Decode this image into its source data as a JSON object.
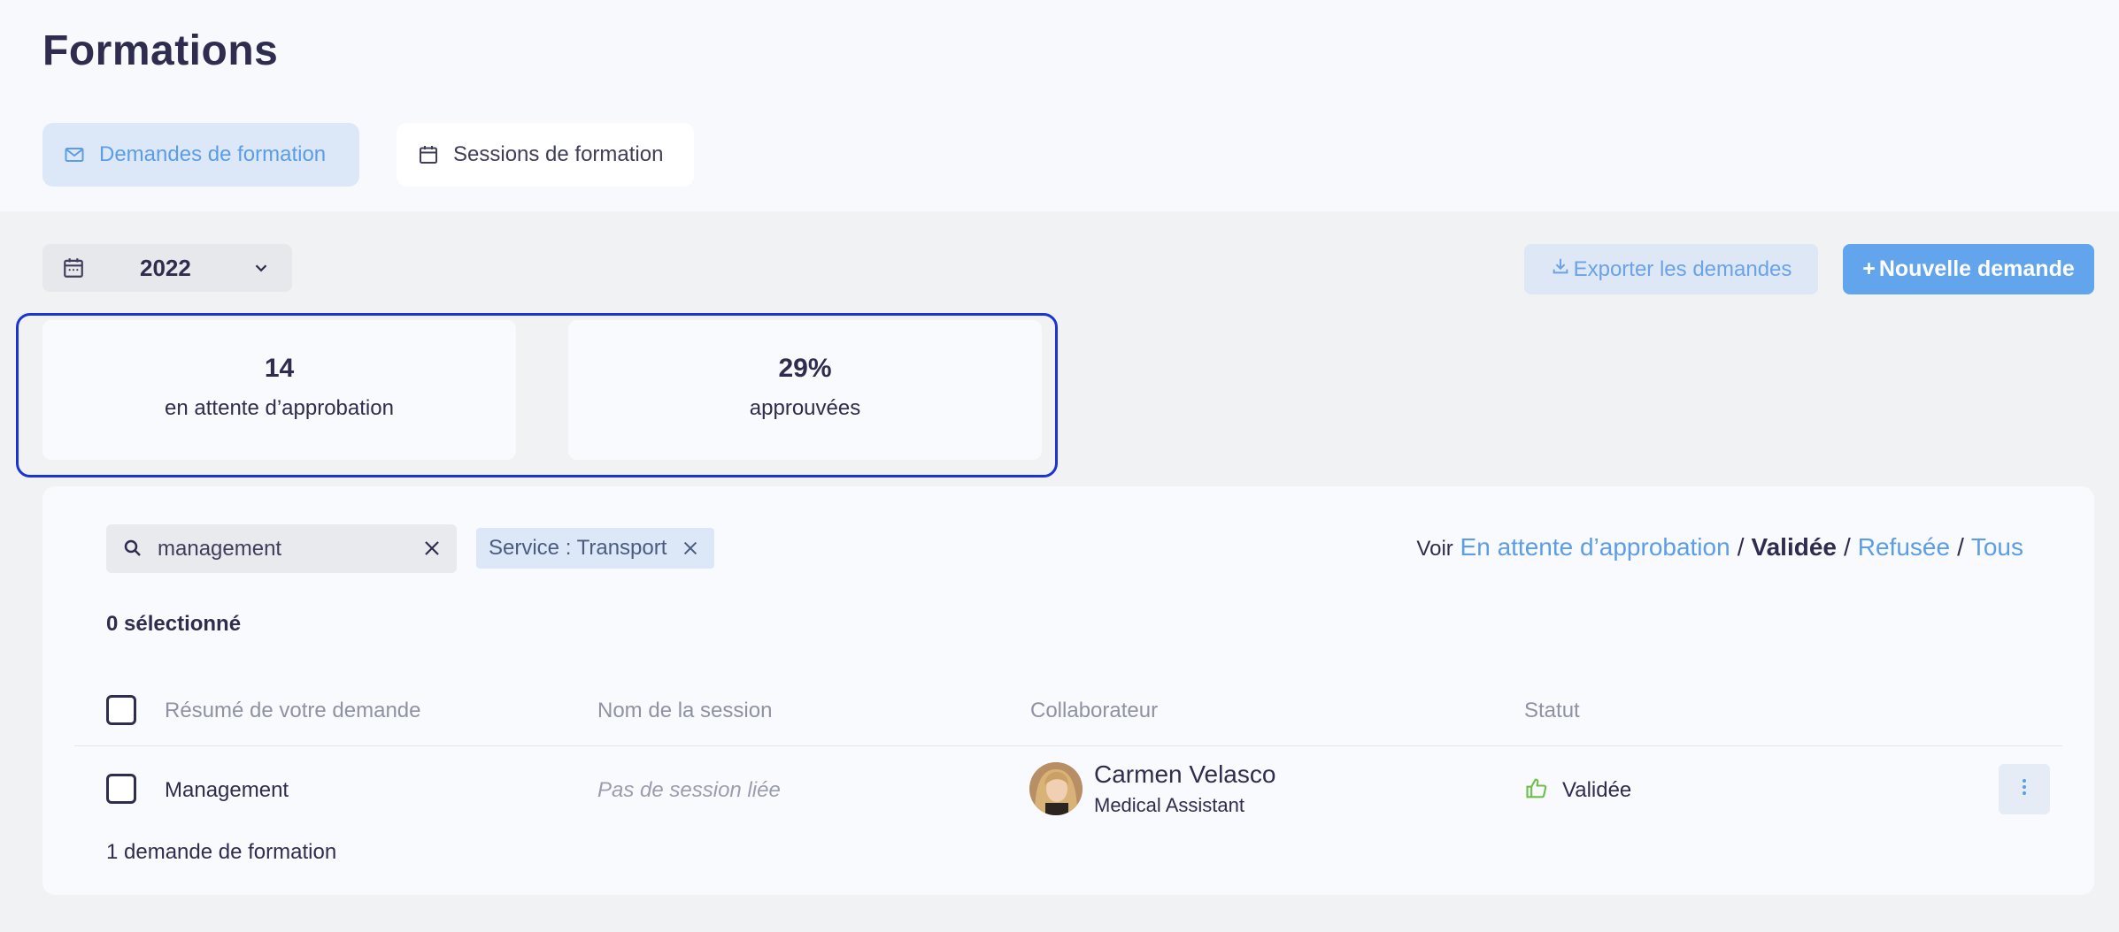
{
  "page": {
    "title": "Formations"
  },
  "tabs": [
    {
      "label": "Demandes de formation",
      "icon": "mail-icon",
      "active": true
    },
    {
      "label": "Sessions de formation",
      "icon": "calendar-icon",
      "active": false
    }
  ],
  "toolbar": {
    "year": "2022",
    "export_label": "Exporter les demandes",
    "new_label": "Nouvelle demande",
    "new_prefix": "+"
  },
  "stats": [
    {
      "value": "14",
      "label": "en attente d’approbation"
    },
    {
      "value": "29%",
      "label": "approuvées"
    }
  ],
  "search": {
    "value": "management"
  },
  "chip": {
    "label": "Service : Transport"
  },
  "filter": {
    "prefix": "Voir",
    "options": [
      "En attente d’approbation",
      "Validée",
      "Refusée",
      "Tous"
    ],
    "current": "Validée"
  },
  "selection": {
    "label": "0 sélectionné"
  },
  "table": {
    "columns": [
      "Résumé de votre demande",
      "Nom de la session",
      "Collaborateur",
      "Statut"
    ],
    "rows": [
      {
        "summary": "Management",
        "session": "Pas de session liée",
        "person_name": "Carmen Velasco",
        "person_role": "Medical Assistant",
        "status": "Validée"
      }
    ],
    "footer": "1 demande de formation"
  },
  "colors": {
    "accent": "#5b9de6",
    "primary_button": "#62a5ec",
    "highlight_border": "#1c33d6",
    "status_ok": "#6cc04a"
  }
}
